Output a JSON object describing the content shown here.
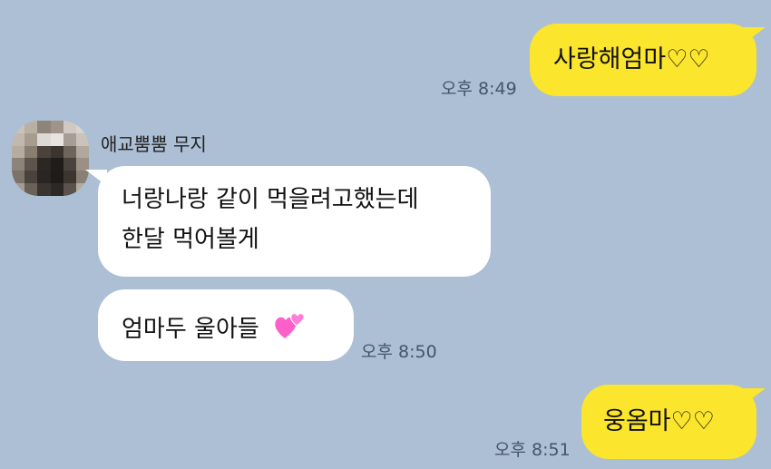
{
  "messages": [
    {
      "text": "사랑해엄마♡♡",
      "time": "오후 8:49"
    },
    {
      "sender": "애교뿜뿜 무지",
      "lines": [
        "너랑나랑 같이 먹을려고했는데",
        "한달 먹어볼게"
      ]
    },
    {
      "text": "엄마두 울아들",
      "emoji": "two-hearts-icon",
      "time": "오후 8:50"
    },
    {
      "text": "웅옴마♡♡",
      "time": "오후 8:51"
    }
  ],
  "colors": {
    "background": "#acbfd4",
    "my_bubble": "#fbe52d",
    "their_bubble": "#ffffff",
    "heart": "#ff5fc8"
  }
}
